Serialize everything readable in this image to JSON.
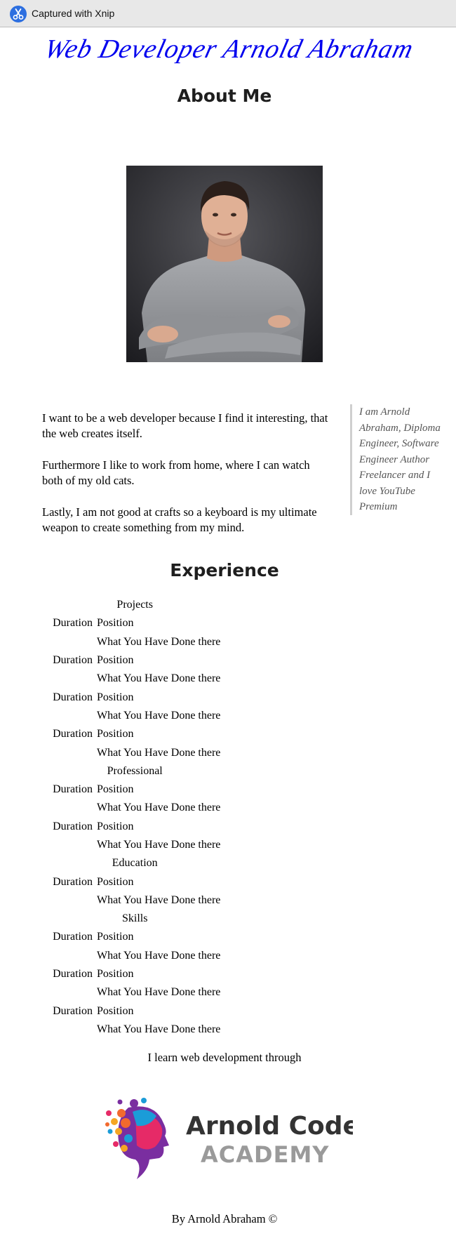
{
  "capture_bar": {
    "label": "Captured with Xnip",
    "icon": "scissors-icon"
  },
  "header": {
    "signature": "Web Developer Arnold Abraham",
    "signature_color": "#0000ee"
  },
  "about": {
    "title": "About Me",
    "photo": "portrait-photo",
    "paragraphs": [
      "I want to be a web developer because I find it interesting, that the web creates itself.",
      "Furthermore I like to work from home, where I can watch both of my old cats.",
      "Lastly, I am not good at crafts so a keyboard is my ultimate weapon to create something from my mind."
    ],
    "aside": "I am Arnold Abraham, Diploma Engineer, Software Engineer Author Freelancer and I love YouTube Premium"
  },
  "experience": {
    "title": "Experience",
    "rows": [
      {
        "cat": "Projects"
      },
      {
        "dur": "Duration",
        "text": "Position"
      },
      {
        "text": "What You Have Done there"
      },
      {
        "dur": "Duration",
        "text": "Position"
      },
      {
        "text": "What You Have Done there"
      },
      {
        "dur": "Duration",
        "text": "Position"
      },
      {
        "text": "What You Have Done there"
      },
      {
        "dur": "Duration",
        "text": "Position"
      },
      {
        "text": "What You Have Done there"
      },
      {
        "cat": "Professional"
      },
      {
        "dur": "Duration",
        "text": "Position"
      },
      {
        "text": "What You Have Done there"
      },
      {
        "dur": "Duration",
        "text": "Position"
      },
      {
        "text": "What You Have Done there"
      },
      {
        "cat": "Education"
      },
      {
        "dur": "Duration",
        "text": "Position"
      },
      {
        "text": "What You Have Done there"
      },
      {
        "cat": "Skills"
      },
      {
        "dur": "Duration",
        "text": "Position"
      },
      {
        "text": "What You Have Done there"
      },
      {
        "dur": "Duration",
        "text": "Position"
      },
      {
        "text": "What You Have Done there"
      },
      {
        "dur": "Duration",
        "text": "Position"
      },
      {
        "text": "What You Have Done there"
      }
    ]
  },
  "learn": {
    "text": "I learn web development through",
    "logo_line1": "Arnold Code",
    "logo_line2": "ACADEMY",
    "logo_colors": {
      "dark": "#333333",
      "light": "#9a9a9a"
    }
  },
  "footer": {
    "text": "By Arnold Abraham ©"
  }
}
